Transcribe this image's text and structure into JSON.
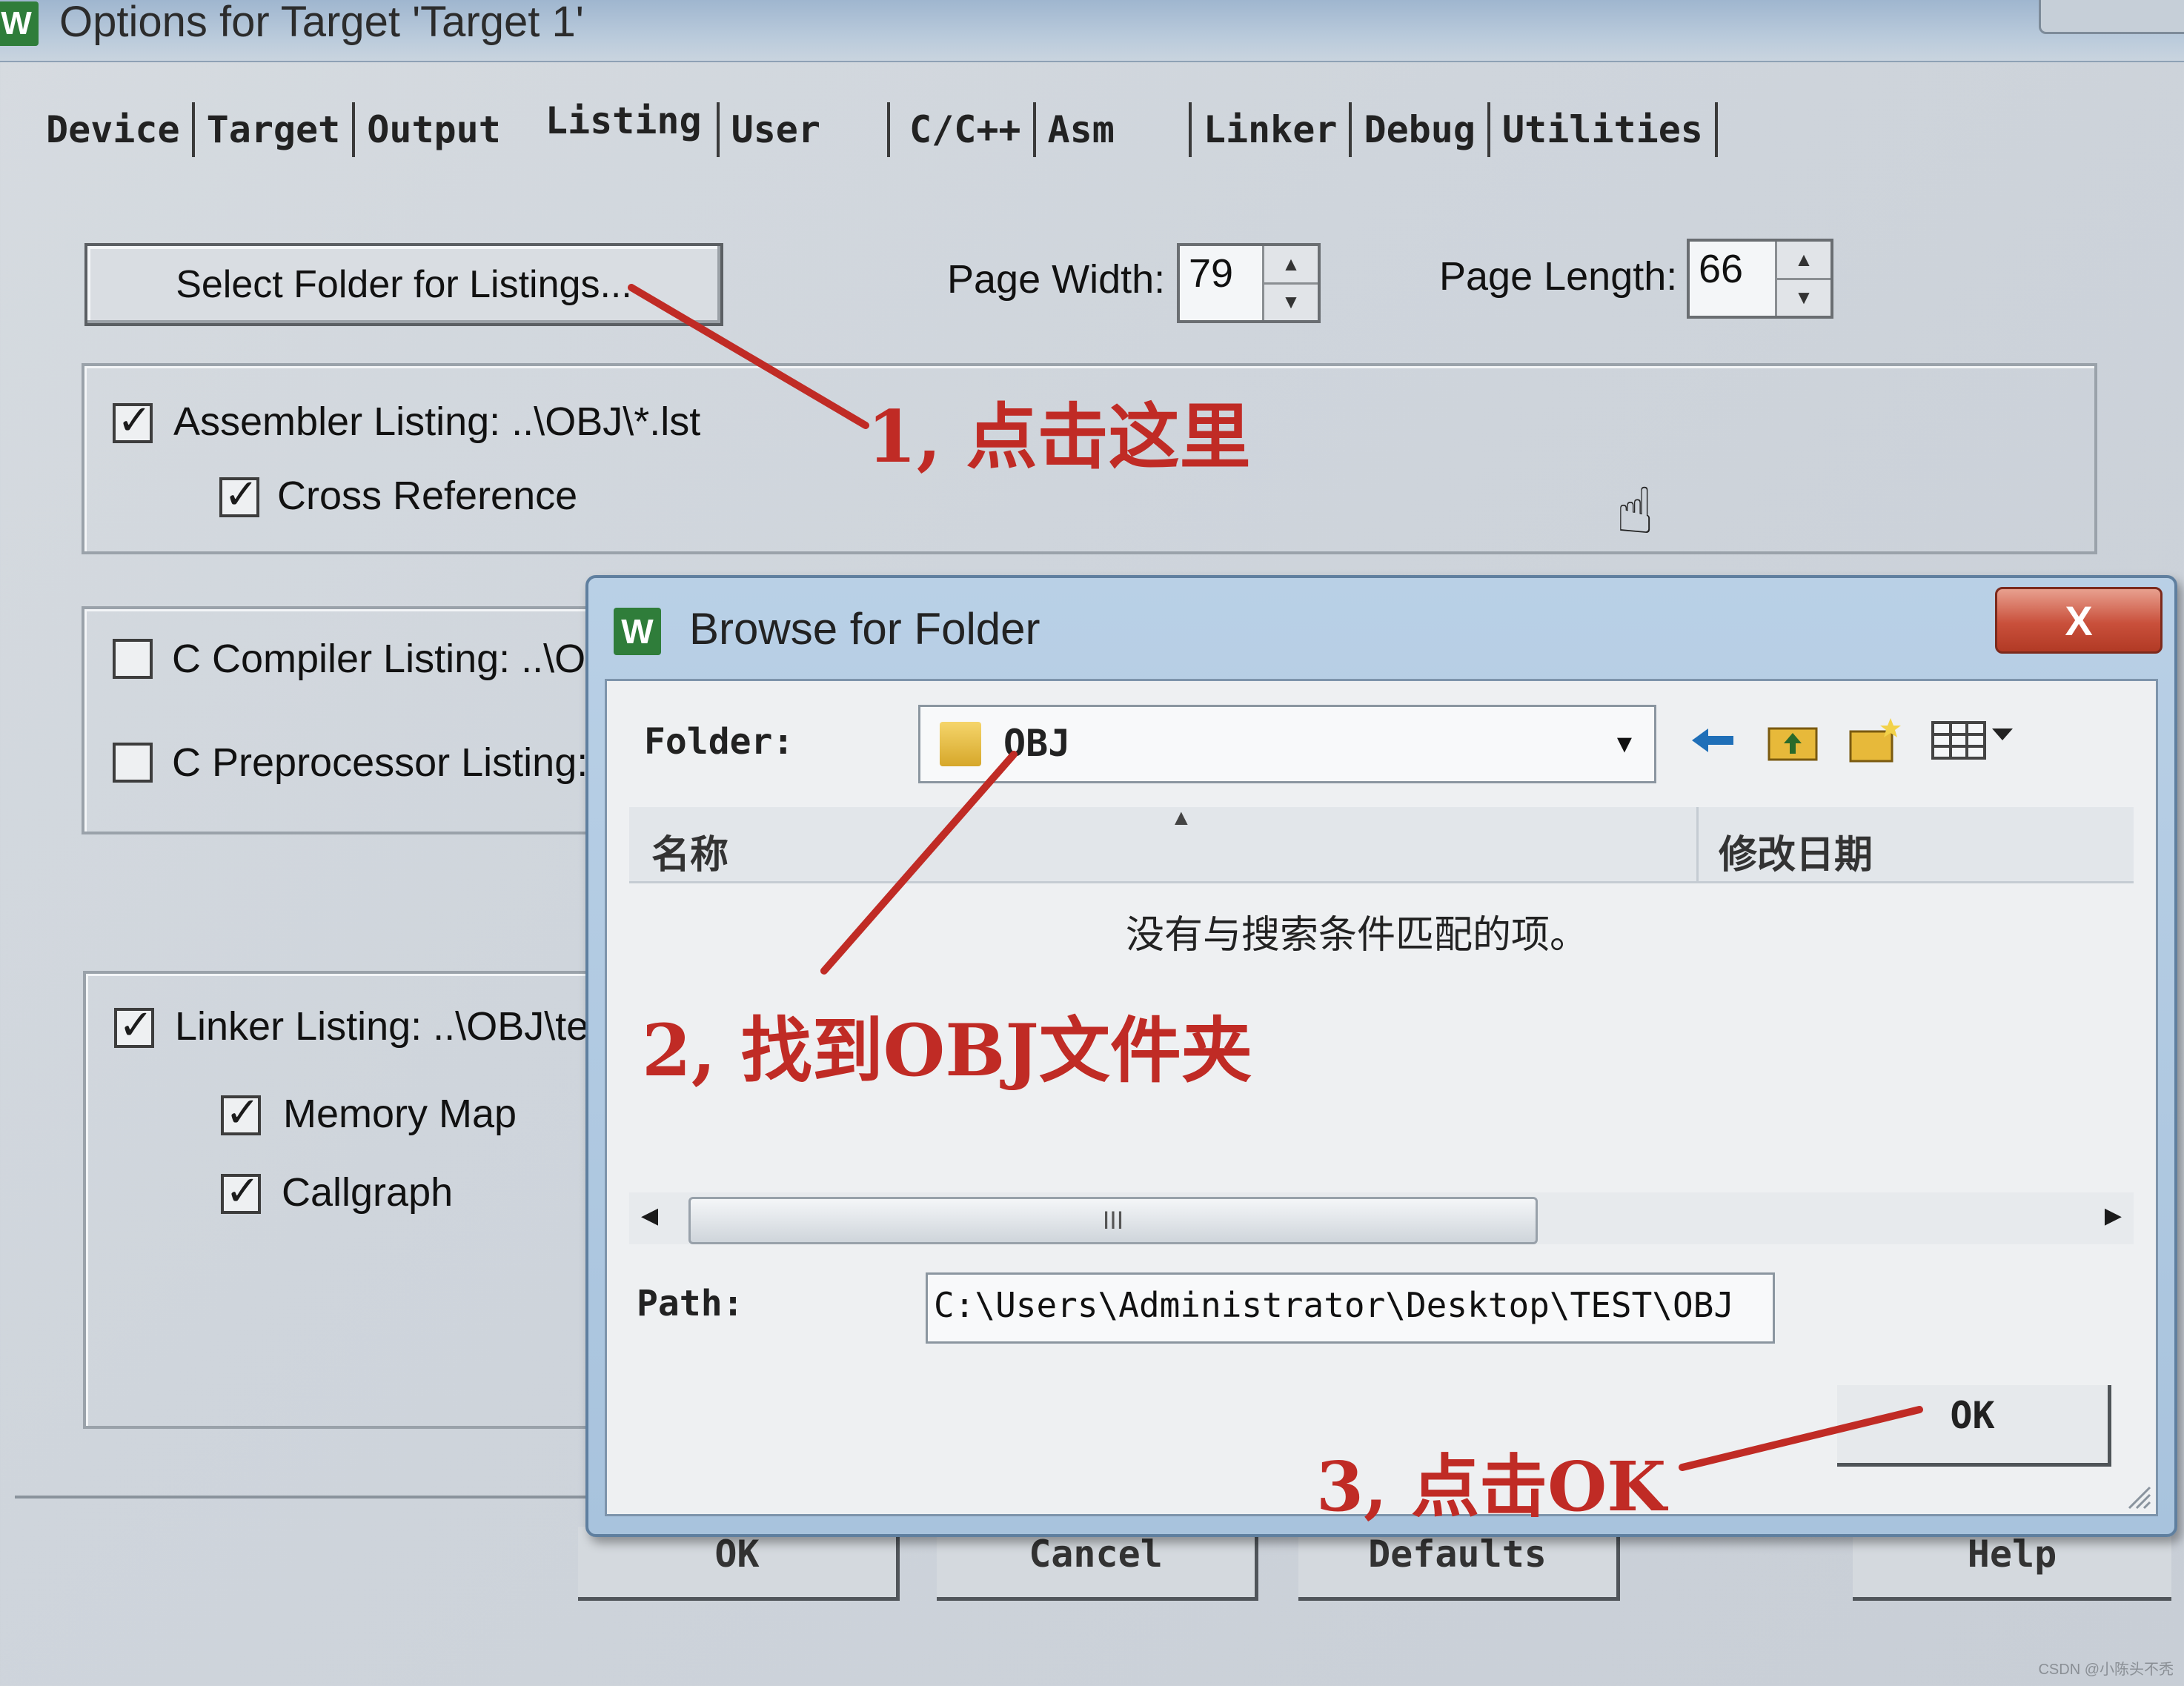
{
  "window": {
    "title": "Options for Target 'Target 1'",
    "icon_letter": "W"
  },
  "tabs": [
    {
      "label": "Device"
    },
    {
      "label": "Target"
    },
    {
      "label": "Output"
    },
    {
      "label": "Listing"
    },
    {
      "label": "User"
    },
    {
      "label": "C/C++"
    },
    {
      "label": "Asm"
    },
    {
      "label": "Linker"
    },
    {
      "label": "Debug"
    },
    {
      "label": "Utilities"
    }
  ],
  "listing": {
    "select_folder_button": "Select Folder for Listings...",
    "page_width_label": "Page Width:",
    "page_width_value": "79",
    "page_length_label": "Page Length:",
    "page_length_value": "66",
    "assembler_listing": "Assembler Listing:  ..\\OBJ\\*.lst",
    "cross_reference": "Cross Reference",
    "c_compiler_listing": "C Compiler Listing:  ..\\OI",
    "c_preprocessor_listing": "C Preprocessor Listing:",
    "linker_listing": "Linker Listing:  ..\\OBJ\\te",
    "memory_map": "Memory Map",
    "callgraph": "Callgraph"
  },
  "bottom_buttons": {
    "ok": "OK",
    "cancel": "Cancel",
    "defaults": "Defaults",
    "help": "Help"
  },
  "dialog": {
    "title": "Browse for Folder",
    "close": "X",
    "folder_label": "Folder:",
    "folder_value": "OBJ",
    "col_name": "名称",
    "col_modified": "修改日期",
    "empty_message": "没有与搜索条件匹配的项。",
    "scroll_grip": "III",
    "path_label": "Path:",
    "path_value": "C:\\Users\\Administrator\\Desktop\\TEST\\OBJ",
    "ok": "OK"
  },
  "annotations": {
    "step1": "1, 点击这里",
    "step2": "2, 找到OBJ文件夹",
    "step3": "3, 点击OK",
    "color": "#c02b25"
  },
  "watermark": "CSDN @小陈头不秃"
}
